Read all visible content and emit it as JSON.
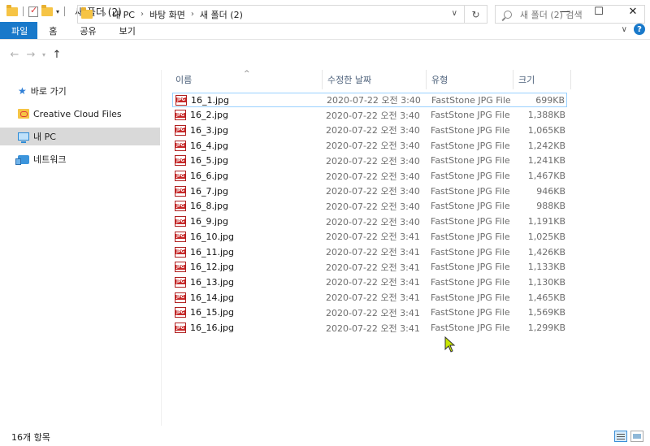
{
  "window": {
    "title": "새 폴더 (2)",
    "controls": {
      "minimize": "—",
      "maximize": "☐",
      "close": "✕"
    }
  },
  "ribbon": {
    "tabs": [
      {
        "label": "파일",
        "active": true
      },
      {
        "label": "홈"
      },
      {
        "label": "공유"
      },
      {
        "label": "보기"
      }
    ],
    "help": "?",
    "expand": "∨"
  },
  "address": {
    "crumbs": [
      "내 PC",
      "바탕 화면",
      "새 폴더 (2)"
    ],
    "search_placeholder": "새 폴더 (2) 검색"
  },
  "sidebar": {
    "items": [
      {
        "label": "바로 가기",
        "icon": "star-icon"
      },
      {
        "label": "Creative Cloud Files",
        "icon": "creative-cloud-folder-icon"
      },
      {
        "label": "내 PC",
        "icon": "pc-icon",
        "selected": true
      },
      {
        "label": "네트워크",
        "icon": "network-icon"
      }
    ]
  },
  "columns": {
    "name": "이름",
    "date": "수정한 날짜",
    "type": "유형",
    "size": "크기"
  },
  "files": [
    {
      "name": "16_1.jpg",
      "date": "2020-07-22 오전 3:40",
      "type": "FastStone JPG File",
      "size": "699KB"
    },
    {
      "name": "16_2.jpg",
      "date": "2020-07-22 오전 3:40",
      "type": "FastStone JPG File",
      "size": "1,388KB"
    },
    {
      "name": "16_3.jpg",
      "date": "2020-07-22 오전 3:40",
      "type": "FastStone JPG File",
      "size": "1,065KB"
    },
    {
      "name": "16_4.jpg",
      "date": "2020-07-22 오전 3:40",
      "type": "FastStone JPG File",
      "size": "1,242KB"
    },
    {
      "name": "16_5.jpg",
      "date": "2020-07-22 오전 3:40",
      "type": "FastStone JPG File",
      "size": "1,241KB"
    },
    {
      "name": "16_6.jpg",
      "date": "2020-07-22 오전 3:40",
      "type": "FastStone JPG File",
      "size": "1,467KB"
    },
    {
      "name": "16_7.jpg",
      "date": "2020-07-22 오전 3:40",
      "type": "FastStone JPG File",
      "size": "946KB"
    },
    {
      "name": "16_8.jpg",
      "date": "2020-07-22 오전 3:40",
      "type": "FastStone JPG File",
      "size": "988KB"
    },
    {
      "name": "16_9.jpg",
      "date": "2020-07-22 오전 3:40",
      "type": "FastStone JPG File",
      "size": "1,191KB"
    },
    {
      "name": "16_10.jpg",
      "date": "2020-07-22 오전 3:41",
      "type": "FastStone JPG File",
      "size": "1,025KB"
    },
    {
      "name": "16_11.jpg",
      "date": "2020-07-22 오전 3:41",
      "type": "FastStone JPG File",
      "size": "1,426KB"
    },
    {
      "name": "16_12.jpg",
      "date": "2020-07-22 오전 3:41",
      "type": "FastStone JPG File",
      "size": "1,133KB"
    },
    {
      "name": "16_13.jpg",
      "date": "2020-07-22 오전 3:41",
      "type": "FastStone JPG File",
      "size": "1,130KB"
    },
    {
      "name": "16_14.jpg",
      "date": "2020-07-22 오전 3:41",
      "type": "FastStone JPG File",
      "size": "1,465KB"
    },
    {
      "name": "16_15.jpg",
      "date": "2020-07-22 오전 3:41",
      "type": "FastStone JPG File",
      "size": "1,569KB"
    },
    {
      "name": "16_16.jpg",
      "date": "2020-07-22 오전 3:41",
      "type": "FastStone JPG File",
      "size": "1,299KB"
    }
  ],
  "file_icon_label": "JPG",
  "status": {
    "count": "16개 항목"
  },
  "colors": {
    "accent": "#1979ca",
    "selection_border": "#99d1ff",
    "nav_selected": "#d9d9d9"
  }
}
